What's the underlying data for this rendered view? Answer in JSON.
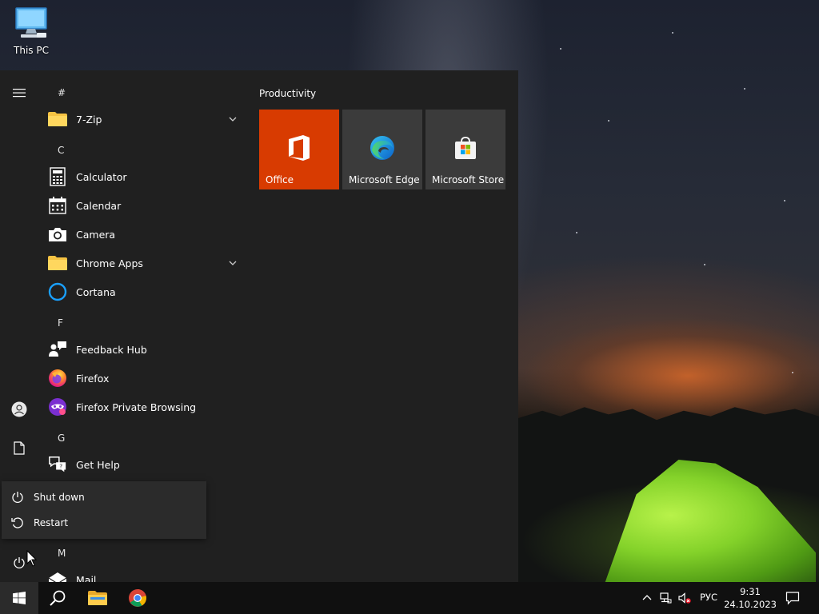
{
  "desktop": {
    "icons": [
      {
        "label": "This PC",
        "icon": "computer-icon"
      }
    ]
  },
  "start_menu": {
    "rail": {
      "menu_icon": "hamburger-icon",
      "user_icon": "user-icon",
      "documents_icon": "document-icon",
      "power_icon": "power-icon"
    },
    "groups": [
      {
        "header": "#",
        "apps": [
          {
            "label": "7-Zip",
            "icon": "folder-icon",
            "expandable": true
          }
        ]
      },
      {
        "header": "C",
        "apps": [
          {
            "label": "Calculator",
            "icon": "calculator-icon"
          },
          {
            "label": "Calendar",
            "icon": "calendar-icon"
          },
          {
            "label": "Camera",
            "icon": "camera-icon"
          },
          {
            "label": "Chrome Apps",
            "icon": "folder-icon",
            "expandable": true
          },
          {
            "label": "Cortana",
            "icon": "cortana-icon"
          }
        ]
      },
      {
        "header": "F",
        "apps": [
          {
            "label": "Feedback Hub",
            "icon": "feedback-icon"
          },
          {
            "label": "Firefox",
            "icon": "firefox-icon"
          },
          {
            "label": "Firefox Private Browsing",
            "icon": "firefox-private-icon"
          }
        ]
      },
      {
        "header": "G",
        "apps": [
          {
            "label": "Get Help",
            "icon": "help-icon"
          }
        ]
      },
      {
        "header": "M",
        "apps": [
          {
            "label": "Mail",
            "icon": "mail-icon"
          }
        ]
      }
    ],
    "tiles": {
      "title": "Productivity",
      "items": [
        {
          "label": "Office",
          "icon": "office-icon",
          "color": "#d83b01"
        },
        {
          "label": "Microsoft Edge",
          "icon": "edge-icon",
          "color": "#3b3b3b"
        },
        {
          "label": "Microsoft Store",
          "icon": "store-icon",
          "color": "#3b3b3b"
        }
      ]
    },
    "power_menu": {
      "items": [
        {
          "label": "Shut down",
          "icon": "power-icon"
        },
        {
          "label": "Restart",
          "icon": "restart-icon"
        }
      ]
    }
  },
  "taskbar": {
    "pinned": [
      {
        "name": "start",
        "icon": "windows-logo-icon"
      },
      {
        "name": "search",
        "icon": "search-icon"
      },
      {
        "name": "file-explorer",
        "icon": "file-explorer-icon"
      },
      {
        "name": "chrome",
        "icon": "chrome-icon"
      }
    ],
    "tray": {
      "language": "РУС",
      "time": "9:31",
      "date": "24.10.2023"
    }
  },
  "colors": {
    "start_bg": "#202020",
    "tile_bg": "#3b3b3b",
    "office": "#d83b01",
    "taskbar_bg": "#101010"
  }
}
